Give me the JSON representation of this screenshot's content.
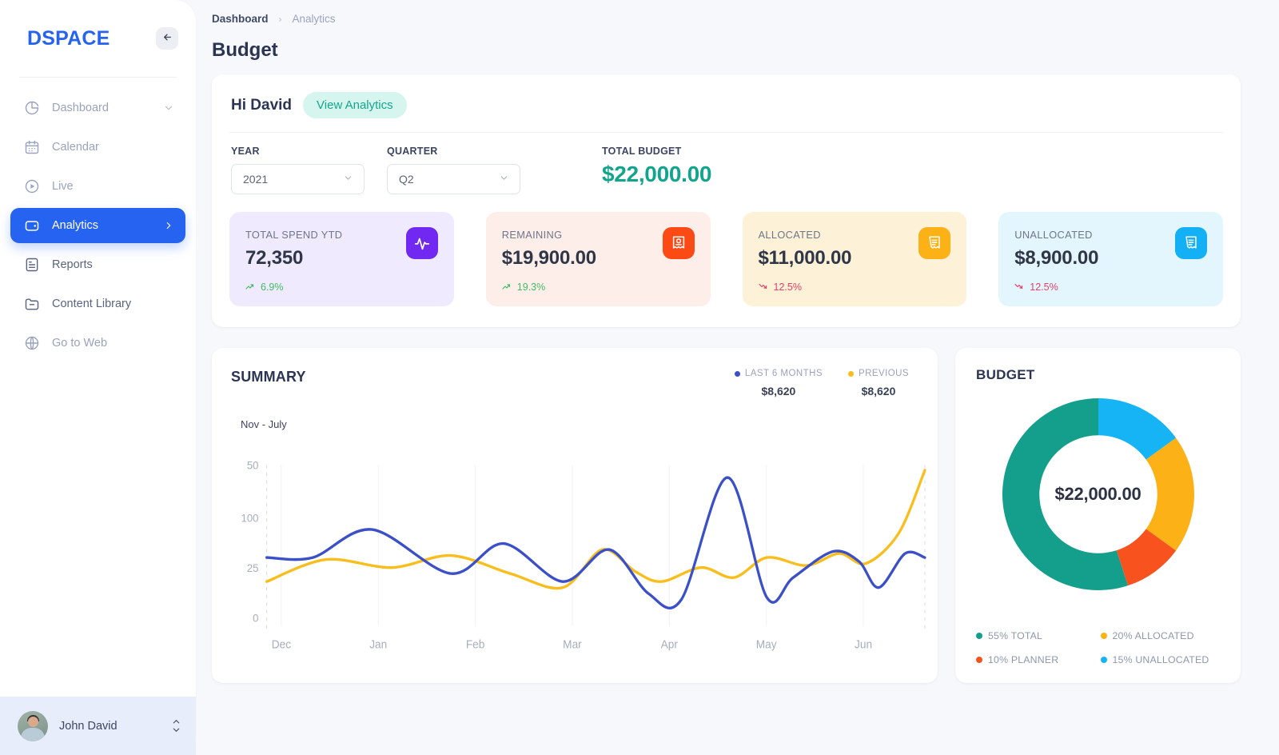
{
  "sidebar": {
    "brand": "DSPACE",
    "collapse_icon": "arrow-left-icon",
    "items": [
      {
        "label": "Dashboard",
        "icon": "pie-chart-icon",
        "state": "muted",
        "trailing": "chevron-down-icon"
      },
      {
        "label": "Calendar",
        "icon": "calendar-icon",
        "state": "muted",
        "trailing": ""
      },
      {
        "label": "Live",
        "icon": "play-circle-icon",
        "state": "muted",
        "trailing": ""
      },
      {
        "label": "Analytics",
        "icon": "wallet-icon",
        "state": "active",
        "trailing": "chevron-right-icon"
      },
      {
        "label": "Reports",
        "icon": "document-icon",
        "state": "dark",
        "trailing": ""
      },
      {
        "label": "Content Library",
        "icon": "folder-minus-icon",
        "state": "dark",
        "trailing": ""
      },
      {
        "label": "Go to Web",
        "icon": "globe-icon",
        "state": "muted",
        "trailing": ""
      }
    ],
    "user": {
      "name": "John David",
      "avatar": "user-avatar",
      "control_icon": "up-down-chevron-icon"
    }
  },
  "breadcrumb": {
    "root": "Dashboard",
    "separator": "›",
    "current": "Analytics"
  },
  "page": {
    "title": "Budget"
  },
  "overview": {
    "greeting": "Hi David",
    "view_analytics_label": "View Analytics",
    "year": {
      "label": "YEAR",
      "value": "2021",
      "caret": "chevron-down-icon"
    },
    "quarter": {
      "label": "QUARTER",
      "value": "Q2",
      "caret": "chevron-down-icon"
    },
    "total_budget": {
      "label": "TOTAL BUDGET",
      "value": "$22,000.00",
      "color": "#12a58c"
    }
  },
  "stats": [
    {
      "label": "TOTAL SPEND YTD",
      "value": "72,350",
      "delta": "6.9%",
      "direction": "up",
      "icon": "activity-pulse-icon",
      "icon_color": "#7128f0",
      "bg": "#efeafd"
    },
    {
      "label": "REMAINING",
      "value": "$19,900.00",
      "delta": "19.3%",
      "direction": "up",
      "icon": "receipt-coin-icon",
      "icon_color": "#fb4a13",
      "bg": "#fdeeea"
    },
    {
      "label": "ALLOCATED",
      "value": "$11,000.00",
      "delta": "12.5%",
      "direction": "down",
      "icon": "receipt-lines-icon",
      "icon_color": "#fcb116",
      "bg": "#fdf1d7"
    },
    {
      "label": "UNALLOCATED",
      "value": "$8,900.00",
      "delta": "12.5%",
      "direction": "down",
      "icon": "receipt-lines-icon",
      "icon_color": "#13b0f5",
      "bg": "#e3f5fd"
    }
  ],
  "summary": {
    "title": "SUMMARY",
    "range_label": "Nov - July",
    "legend": [
      {
        "name": "LAST 6 MONTHS",
        "value": "$8,620",
        "color": "#3a4fc8"
      },
      {
        "name": "PREVIOUS",
        "value": "$8,620",
        "color": "#f9bd1c"
      }
    ]
  },
  "budget": {
    "title": "BUDGET",
    "center_value": "$22,000.00",
    "legend": [
      {
        "label": "55% TOTAL",
        "color": "#149e8c"
      },
      {
        "label": "20% ALLOCATED",
        "color": "#fcb116"
      },
      {
        "label": "10% PLANNER",
        "color": "#f8521e"
      },
      {
        "label": "15% UNALLOCATED",
        "color": "#17b4f5"
      }
    ]
  },
  "chart_data": [
    {
      "type": "line",
      "title": "SUMMARY",
      "subtitle": "Nov - July",
      "xlabel": "",
      "ylabel": "",
      "x": [
        "Dec",
        "Jan",
        "Feb",
        "Mar",
        "Apr",
        "May",
        "Jun"
      ],
      "tick_labels_y": [
        "0",
        "25",
        "50",
        "100"
      ],
      "ylim": [
        0,
        100
      ],
      "grid": "vertical-only",
      "legend_position": "top-right",
      "series": [
        {
          "name": "LAST 6 MONTHS",
          "color": "#3a4fc8",
          "total": "$8,620",
          "values": [
            30,
            30,
            44,
            22,
            37,
            18,
            34,
            12,
            9,
            62,
            10,
            20,
            33,
            28,
            15,
            32,
            30
          ],
          "x_fractions": [
            0.0,
            0.07,
            0.16,
            0.28,
            0.36,
            0.45,
            0.52,
            0.58,
            0.63,
            0.7,
            0.76,
            0.8,
            0.86,
            0.9,
            0.93,
            0.97,
            1.0
          ]
        },
        {
          "name": "PREVIOUS",
          "color": "#f9bd1c",
          "total": "$8,620",
          "values": [
            18,
            29,
            25,
            31,
            22,
            15,
            34,
            23,
            18,
            25,
            20,
            30,
            26,
            32,
            27,
            42,
            55
          ],
          "x_fractions": [
            0.0,
            0.09,
            0.19,
            0.28,
            0.37,
            0.45,
            0.51,
            0.56,
            0.6,
            0.66,
            0.71,
            0.76,
            0.82,
            0.87,
            0.91,
            0.96,
            1.0
          ]
        }
      ]
    },
    {
      "type": "pie",
      "variant": "donut",
      "title": "BUDGET",
      "center_label": "$22,000.00",
      "labels": [
        "55% TOTAL",
        "15% UNALLOCATED",
        "20% ALLOCATED",
        "10% PLANNER"
      ],
      "values": [
        55,
        15,
        20,
        10
      ],
      "colors": [
        "#149e8c",
        "#17b4f5",
        "#fcb116",
        "#f8521e"
      ],
      "legend_position": "bottom"
    }
  ]
}
